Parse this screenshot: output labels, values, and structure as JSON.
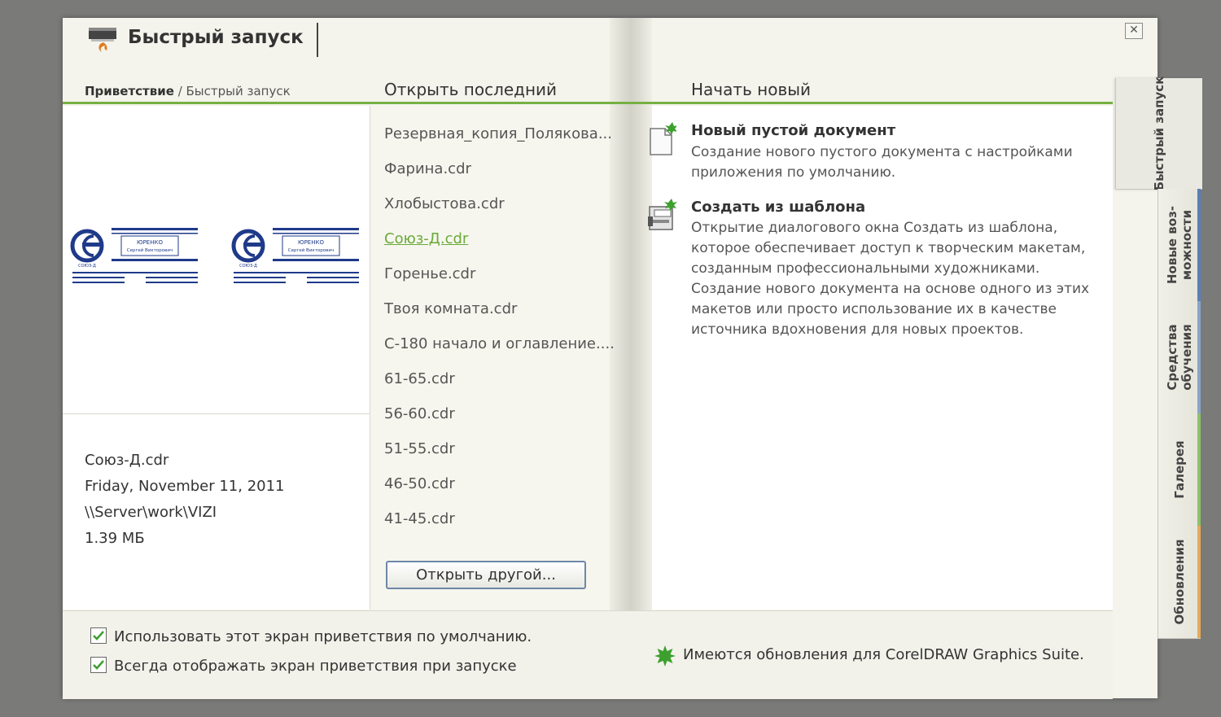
{
  "header": {
    "title": "Быстрый запуск",
    "close_label": "✕"
  },
  "breadcrumb": {
    "root": "Приветствие",
    "separator": " / ",
    "current": "Быстрый запуск"
  },
  "recent": {
    "title": "Открыть последний",
    "items": [
      "Резервная_копия_Полякова...",
      "Фарина.cdr",
      "Хлобыстова.cdr",
      "Союз-Д.cdr",
      "Горенье.cdr",
      "Твоя комната.cdr",
      "С-180 начало и оглавление....",
      "61-65.cdr",
      "56-60.cdr",
      "51-55.cdr",
      "46-50.cdr",
      "41-45.cdr"
    ],
    "active_index": 3,
    "open_other_label": "Открыть другой..."
  },
  "preview": {
    "logo_text_line1": "ЮРЕНКО",
    "logo_text_line2": "Сергей Викторович",
    "logo_caption": "СОЮЗ-Д"
  },
  "file_info": {
    "name": "Союз-Д.cdr",
    "date": "Friday, November 11, 2011",
    "path": "\\\\Server\\work\\VIZI",
    "size": "1.39 МБ"
  },
  "new_section": {
    "title": "Начать новый",
    "items": [
      {
        "title": "Новый пустой документ",
        "description": "Создание нового пустого документа с настройками приложения по умолчанию."
      },
      {
        "title": "Создать из шаблона",
        "description": "Открытие диалогового окна Создать из шаблона, которое обеспечивает доступ к творческим макетам, созданным профессиональными художниками. Создание нового документа на основе одного из этих макетов или просто использование их в качестве источника вдохновения для новых проектов."
      }
    ]
  },
  "footer": {
    "checkbox1_label": "Использовать этот экран приветствия по умолчанию.",
    "checkbox1_checked": true,
    "checkbox2_label": "Всегда отображать экран приветствия при запуске",
    "checkbox2_checked": true,
    "update_text": "Имеются обновления для CorelDRAW Graphics Suite."
  },
  "tabs": [
    {
      "label": "Быстрый запуск",
      "active": true,
      "accent": "#e9e9e1"
    },
    {
      "label": "Новые воз- можности",
      "active": false,
      "accent": "#5b7fb5"
    },
    {
      "label": "Средства обучения",
      "active": false,
      "accent": "#8aa3c8"
    },
    {
      "label": "Галерея",
      "active": false,
      "accent": "#8cc06a"
    },
    {
      "label": "Обновления",
      "active": false,
      "accent": "#e8a85a"
    }
  ],
  "colors": {
    "accent_green": "#76b043",
    "link_green": "#6aaa3a",
    "logo_blue": "#1f3a8a"
  }
}
